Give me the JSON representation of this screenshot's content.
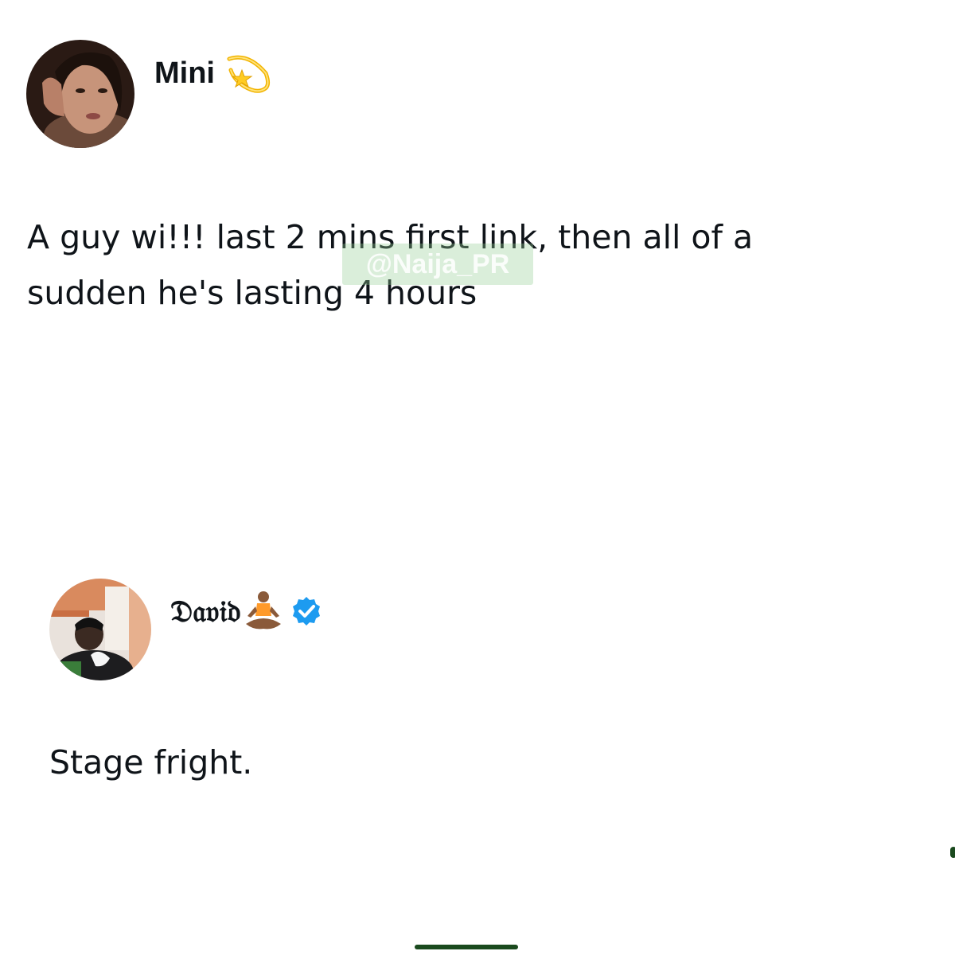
{
  "post1": {
    "display_name": "Mini",
    "name_emoji_icon": "dizzy-star-icon",
    "text_line1": "A guy wi!!! last 2 mins first link, then all of a",
    "text_line2": "sudden he's lasting 4 hours"
  },
  "watermark": {
    "text": "@Naija_PR"
  },
  "post2": {
    "display_name": "𝔇𝔞𝔳𝔦𝔡",
    "name_emoji_icon": "person-meditating-icon",
    "verified_icon": "verified-badge-icon",
    "text": "Stage fright."
  },
  "colors": {
    "text": "#0f1419",
    "verified_blue": "#1d9bf0",
    "home_indicator": "#1a4a1e",
    "watermark_bg": "#96cd96"
  }
}
